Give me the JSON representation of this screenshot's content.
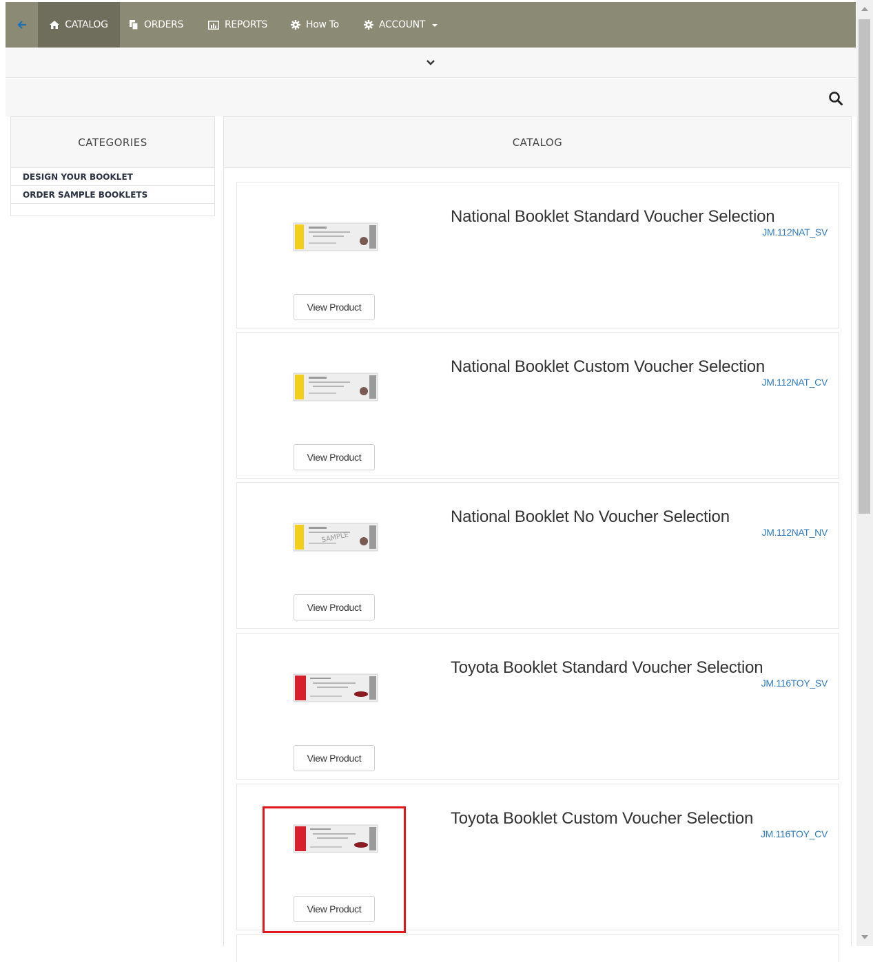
{
  "nav": {
    "catalog_label": "CATALOG",
    "orders_label": "ORDERS",
    "reports_label": "REPORTS",
    "howto_label": "How To",
    "account_label": "ACCOUNT",
    "bg_color": "#8b8a75",
    "active_color": "#6f6d5b"
  },
  "sidebar": {
    "title": "CATEGORIES",
    "items": [
      {
        "label": "DESIGN YOUR BOOKLET"
      },
      {
        "label": "ORDER SAMPLE BOOKLETS"
      }
    ]
  },
  "catalog": {
    "title": "CATALOG",
    "products": [
      {
        "title": "National Booklet Standard Voucher Selection",
        "code": "JM.112NAT_SV",
        "button": "View Product",
        "accent": "#f2cf1d"
      },
      {
        "title": "National Booklet Custom Voucher Selection",
        "code": "JM.112NAT_CV",
        "button": "View Product",
        "accent": "#f2cf1d"
      },
      {
        "title": "National Booklet No Voucher Selection",
        "code": "JM.112NAT_NV",
        "button": "View Product",
        "accent": "#f2cf1d",
        "watermark": "SAMPLE"
      },
      {
        "title": "Toyota Booklet Standard Voucher Selection",
        "code": "JM.116TOY_SV",
        "button": "View Product",
        "accent": "#d6202e"
      },
      {
        "title": "Toyota Booklet Custom Voucher Selection",
        "code": "JM.116TOY_CV",
        "button": "View Product",
        "accent": "#d6202e"
      }
    ]
  },
  "colors": {
    "link": "#2f7cc0",
    "highlight": "#e2141c"
  }
}
